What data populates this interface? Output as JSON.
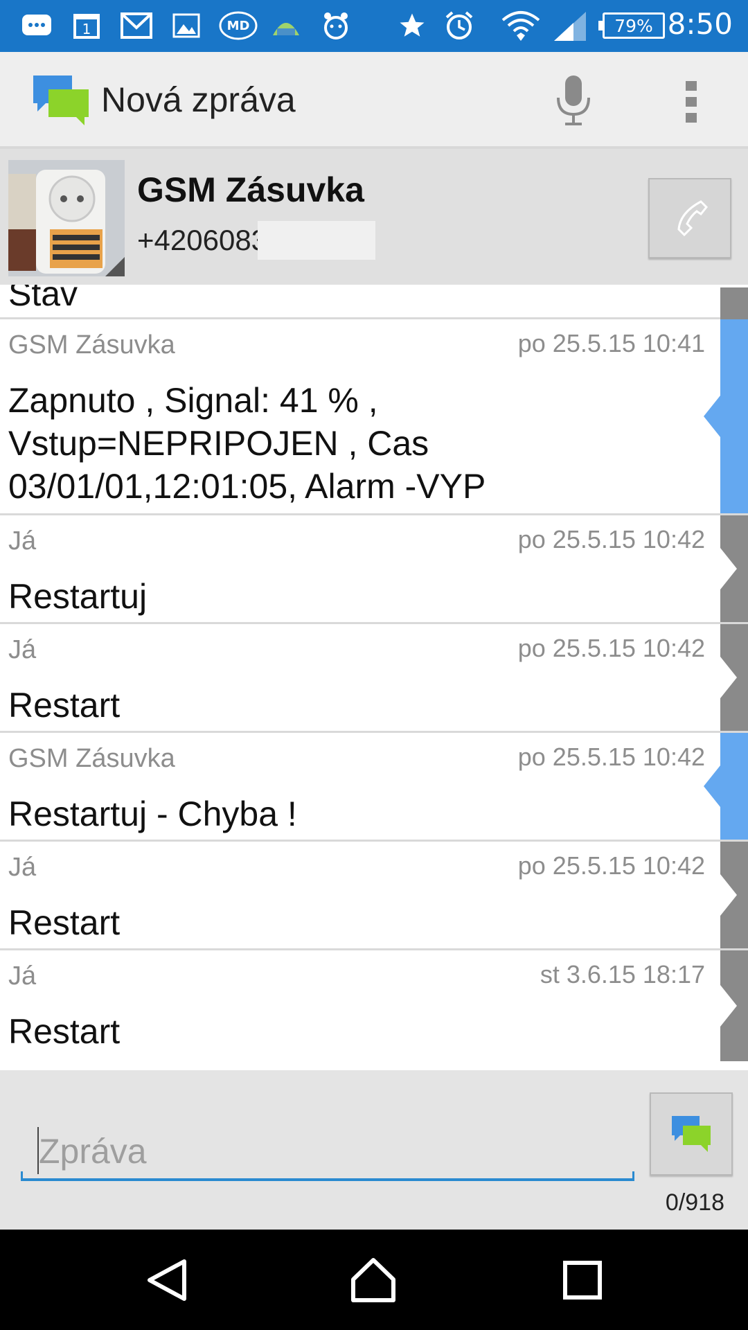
{
  "status_bar": {
    "time": "8:50",
    "battery": "79%",
    "icons": [
      "chat-icon",
      "calendar-icon",
      "gmail-icon",
      "gallery-icon",
      "md-app-icon",
      "android-icon",
      "alarm-app-icon",
      "star-icon",
      "alarm-clock-icon",
      "wifi-icon",
      "signal-icon",
      "battery-icon"
    ],
    "calendar_day": "1"
  },
  "action_bar": {
    "title": "Nová zpráva"
  },
  "contact": {
    "name": "GSM Zásuvka",
    "number": "+4206083"
  },
  "messages": [
    {
      "sender": "",
      "time": "",
      "body": "Stav",
      "type": "outgoing"
    },
    {
      "sender": "GSM Zásuvka",
      "time": "po 25.5.15 10:41",
      "body": "Zapnuto , Signal: 41 % , Vstup=NEPRIPOJEN , Cas 03/01/01,12:01:05, Alarm -VYP",
      "type": "incoming"
    },
    {
      "sender": "Já",
      "time": "po 25.5.15 10:42",
      "body": "Restartuj",
      "type": "outgoing"
    },
    {
      "sender": "Já",
      "time": "po 25.5.15 10:42",
      "body": "Restart",
      "type": "outgoing"
    },
    {
      "sender": "GSM Zásuvka",
      "time": "po 25.5.15 10:42",
      "body": "Restartuj - Chyba !",
      "type": "incoming"
    },
    {
      "sender": "Já",
      "time": "po 25.5.15 10:42",
      "body": "Restart",
      "type": "outgoing"
    },
    {
      "sender": "Já",
      "time": "st 3.6.15 18:17",
      "body": "Restart",
      "type": "outgoing"
    }
  ],
  "compose": {
    "placeholder": "Zpráva",
    "counter": "0/918"
  },
  "colors": {
    "status_bar": "#1976c8",
    "incoming_tab": "#64a8f0",
    "outgoing_tab": "#8a8a8a",
    "input_line": "#2a8ad0"
  }
}
